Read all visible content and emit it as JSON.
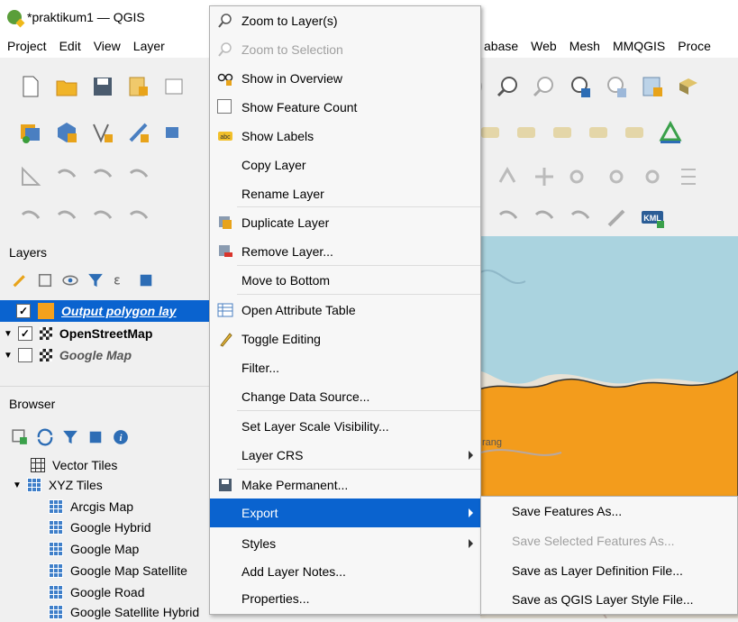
{
  "window": {
    "title": "*praktikum1 — QGIS"
  },
  "menubar": {
    "left": [
      "Project",
      "Edit",
      "View",
      "Layer"
    ],
    "right": [
      "abase",
      "Web",
      "Mesh",
      "MMQGIS",
      "Proce"
    ]
  },
  "layers_panel": {
    "title": "Layers",
    "items": [
      {
        "label": "Output polygon lay",
        "checked": true,
        "selected": true
      },
      {
        "label": "OpenStreetMap",
        "checked": true,
        "bold": true
      },
      {
        "label": "Google Map",
        "checked": false,
        "italic": true
      }
    ]
  },
  "browser_panel": {
    "title": "Browser",
    "items": [
      {
        "label": "Vector Tiles",
        "level": 1
      },
      {
        "label": "XYZ Tiles",
        "level": 1,
        "expanded": true
      },
      {
        "label": "Arcgis Map",
        "level": 2
      },
      {
        "label": "Google Hybrid",
        "level": 2
      },
      {
        "label": "Google Map",
        "level": 2
      },
      {
        "label": "Google Map Satellite",
        "level": 2
      },
      {
        "label": "Google Road",
        "level": 2
      },
      {
        "label": "Google Satellite Hybrid",
        "level": 2
      }
    ]
  },
  "context_menu": {
    "items": [
      {
        "label": "Zoom to Layer(s)",
        "icon": "zoom-icon"
      },
      {
        "label": "Zoom to Selection",
        "icon": "zoom-selection-icon",
        "disabled": true
      },
      {
        "label": "Show in Overview",
        "icon": "overview-icon"
      },
      {
        "label": "Show Feature Count",
        "icon": "checkbox-icon"
      },
      {
        "label": "Show Labels",
        "icon": "labels-icon"
      },
      {
        "label": "Copy Layer"
      },
      {
        "label": "Rename Layer"
      },
      {
        "label": "Duplicate Layer",
        "icon": "duplicate-icon"
      },
      {
        "label": "Remove Layer...",
        "icon": "remove-icon"
      },
      {
        "label": "Move to Bottom"
      },
      {
        "label": "Open Attribute Table",
        "icon": "table-icon"
      },
      {
        "label": "Toggle Editing",
        "icon": "pencil-icon"
      },
      {
        "label": "Filter..."
      },
      {
        "label": "Change Data Source..."
      },
      {
        "label": "Set Layer Scale Visibility..."
      },
      {
        "label": "Layer CRS",
        "submenu": true
      },
      {
        "label": "Make Permanent...",
        "icon": "save-icon"
      },
      {
        "label": "Export",
        "submenu": true,
        "active": true
      },
      {
        "label": "Styles",
        "submenu": true
      },
      {
        "label": "Add Layer Notes..."
      },
      {
        "label": "Properties..."
      }
    ]
  },
  "export_submenu": {
    "items": [
      {
        "label": "Save Features As..."
      },
      {
        "label": "Save Selected Features As...",
        "disabled": true
      },
      {
        "label": "Save as Layer Definition File..."
      },
      {
        "label": "Save as QGIS Layer Style File..."
      }
    ]
  },
  "map": {
    "label": "rang",
    "kml_badge": "KML"
  }
}
